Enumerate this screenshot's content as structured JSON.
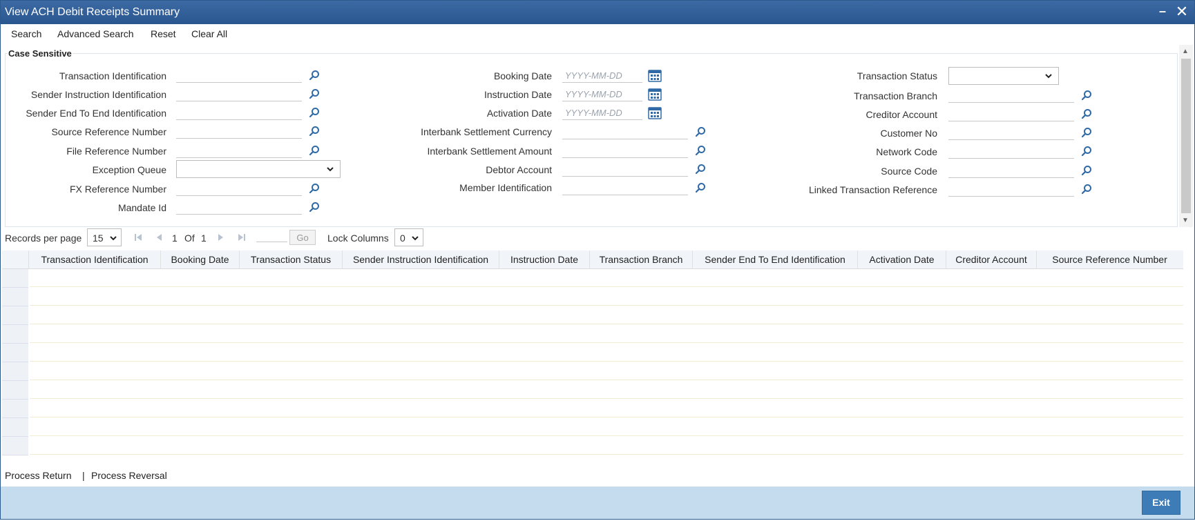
{
  "window": {
    "title": "View ACH Debit Receipts Summary"
  },
  "toolbar": {
    "search": "Search",
    "advanced_search": "Advanced Search",
    "reset": "Reset",
    "clear_all": "Clear All"
  },
  "criteria": {
    "legend": "Case Sensitive",
    "date_placeholder": "YYYY-MM-DD",
    "col1": [
      "Transaction Identification",
      "Sender Instruction Identification",
      "Sender End To End Identification",
      "Source Reference Number",
      "File Reference Number",
      "Exception Queue",
      "FX Reference Number",
      "Mandate Id"
    ],
    "col2": [
      "Booking Date",
      "Instruction Date",
      "Activation Date",
      "Interbank Settlement Currency",
      "Interbank Settlement Amount",
      "Debtor Account",
      "Member Identification"
    ],
    "col3": [
      "Transaction Status",
      "Transaction Branch",
      "Creditor Account",
      "Customer No",
      "Network Code",
      "Source Code",
      "Linked Transaction Reference"
    ]
  },
  "pager": {
    "records_label": "Records per page",
    "records_value": "15",
    "current_page": "1",
    "of_label": "Of",
    "total_pages": "1",
    "go_label": "Go",
    "lock_label": "Lock Columns",
    "lock_value": "0"
  },
  "grid": {
    "columns": [
      "Transaction Identification",
      "Booking Date",
      "Transaction Status",
      "Sender Instruction Identification",
      "Instruction Date",
      "Transaction Branch",
      "Sender End To End Identification",
      "Activation Date",
      "Creditor Account",
      "Source Reference Number"
    ]
  },
  "actions": {
    "process_return": "Process Return",
    "separator": "|",
    "process_reversal": "Process Reversal"
  },
  "footer": {
    "exit": "Exit"
  },
  "colors": {
    "titlebar": "#2a5690",
    "footer": "#c5dcef",
    "exit_button": "#3d7cb6",
    "icon": "#2f6aa6"
  }
}
